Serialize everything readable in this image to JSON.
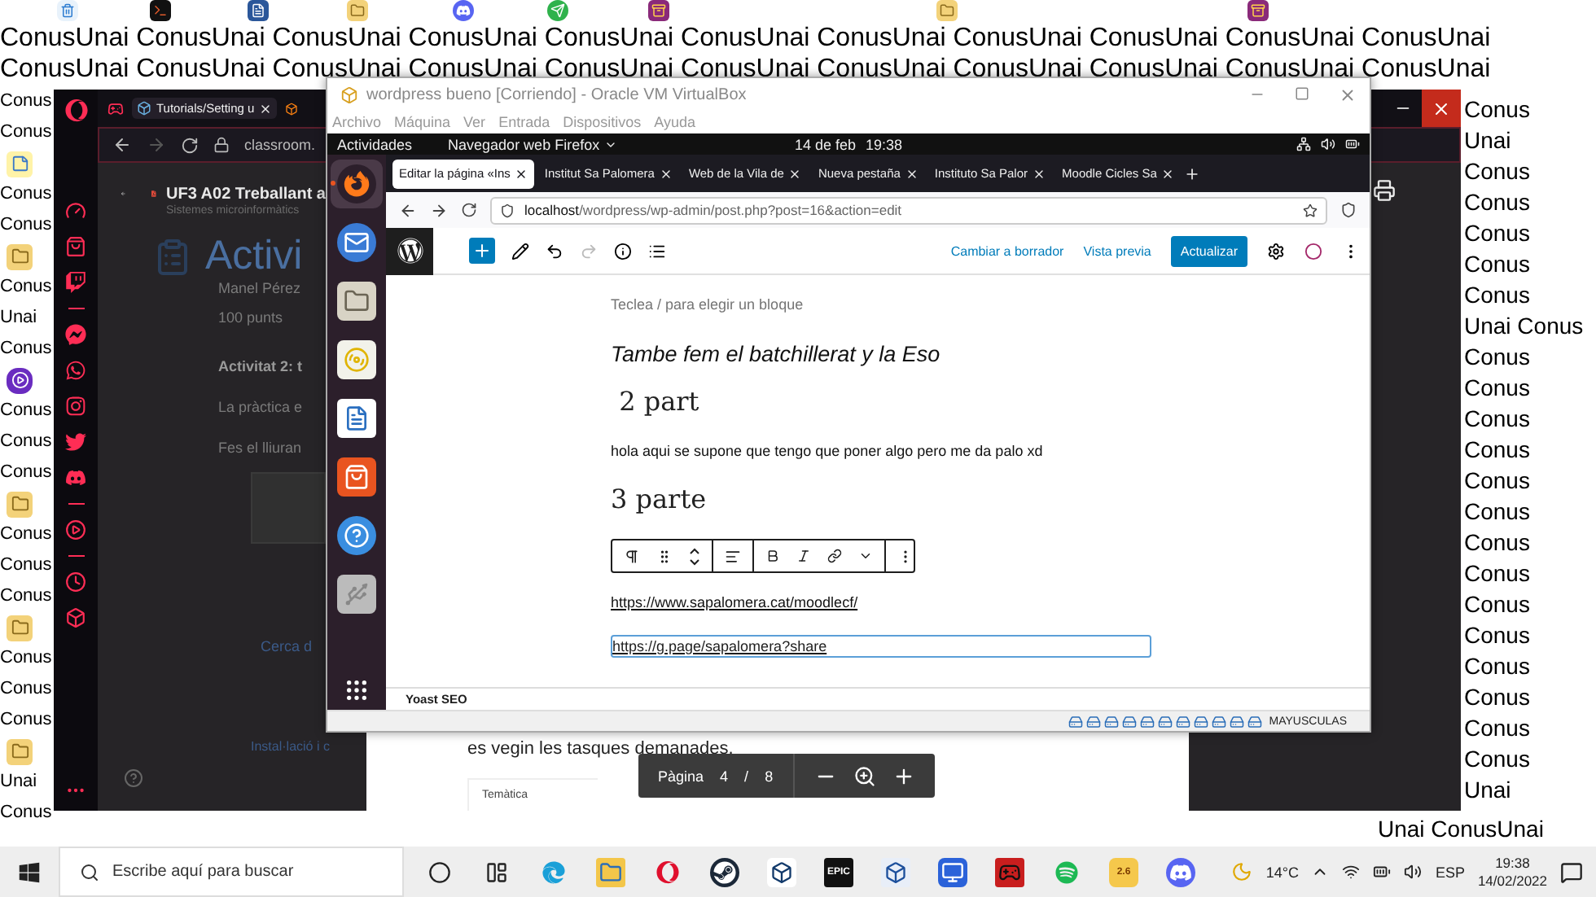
{
  "wallpaper": {
    "top_lines": [
      "ConusUnai ConusUnai ConusUnai ConusUnai ConusUnai ConusUnai ConusUnai ConusUnai ConusUnai ConusUnai ConusUnai",
      "ConusUnai ConusUnai ConusUnai ConusUnai ConusUnai ConusUnai ConusUnai ConusUnai ConusUnai ConusUnai ConusUnai"
    ],
    "left_lines": [
      {
        "kind": "text",
        "text": "Conus"
      },
      {
        "kind": "text",
        "text": "Conus"
      },
      {
        "kind": "notes"
      },
      {
        "kind": "text",
        "text": "Conus"
      },
      {
        "kind": "text",
        "text": "Conus"
      },
      {
        "kind": "folder"
      },
      {
        "kind": "text",
        "text": "Conus"
      },
      {
        "kind": "text",
        "text": "Unai"
      },
      {
        "kind": "text",
        "text": "Conus"
      },
      {
        "kind": "player"
      },
      {
        "kind": "text",
        "text": "Conus"
      },
      {
        "kind": "text",
        "text": "Conus"
      },
      {
        "kind": "text",
        "text": "Conus"
      },
      {
        "kind": "folder"
      },
      {
        "kind": "text",
        "text": "Conus"
      },
      {
        "kind": "text",
        "text": "Conus"
      },
      {
        "kind": "text",
        "text": "Conus"
      },
      {
        "kind": "folder"
      },
      {
        "kind": "text",
        "text": "Conus"
      },
      {
        "kind": "text",
        "text": "Conus"
      },
      {
        "kind": "text",
        "text": "Conus"
      },
      {
        "kind": "folder"
      },
      {
        "kind": "text",
        "text": "Unai"
      },
      {
        "kind": "text",
        "text": "Conus"
      }
    ],
    "corner_lines": [
      "Unai ConusUnai"
    ],
    "right_lines": [
      "Conus",
      "Unai",
      "Conus",
      "Conus",
      "Conus",
      "Conus",
      "Conus",
      "Unai Conus",
      "Conus",
      "Conus",
      "Conus",
      "Conus",
      "Conus",
      "Conus",
      "Conus",
      "Conus",
      "Conus",
      "Conus",
      "Conus",
      "Conus",
      "Conus",
      "Conus",
      "Unai"
    ]
  },
  "desktop_icons": [
    {
      "kind": "bin"
    },
    {
      "kind": "terminal"
    },
    {
      "kind": "document"
    },
    {
      "kind": "folder"
    },
    {
      "kind": "chat"
    },
    {
      "kind": "send"
    },
    {
      "kind": "archive"
    },
    {
      "kind": "folder"
    },
    {
      "kind": "archive"
    }
  ],
  "opera": {
    "sidebar": [
      {
        "kind": "gauge"
      },
      {
        "kind": "bag"
      },
      {
        "kind": "twitch"
      },
      {
        "kind": "divider"
      },
      {
        "kind": "messenger"
      },
      {
        "kind": "whatsapp"
      },
      {
        "kind": "instagram"
      },
      {
        "kind": "twitter"
      },
      {
        "kind": "discord"
      },
      {
        "kind": "divider"
      },
      {
        "kind": "player"
      },
      {
        "kind": "divider"
      },
      {
        "kind": "history"
      },
      {
        "kind": "cube"
      }
    ],
    "tabs": [
      {
        "label": "Tutorials/Setting u",
        "selected": true
      }
    ],
    "address": "classroom.",
    "pdf_title": "UF3 A02 Treballant a",
    "pdf_subtitle": "Sistemes microinformàtics",
    "classroom": {
      "title": "Activi",
      "author": "Manel Pérez",
      "points": "100 punts",
      "heading": "Activitat 2: t",
      "lines": [
        "La pràctica e",
        "Fes el lliuran"
      ],
      "section": "Cerca d",
      "attachment": "Instal·lació i c"
    },
    "pdf": {
      "text": "es vegin les tasques demanades.",
      "card": "Temàtica",
      "page_label": "Pàgina",
      "page": "4",
      "separator": "/",
      "total": "8"
    }
  },
  "vm": {
    "title": "wordpress bueno [Corriendo] - Oracle VM VirtualBox",
    "menu": [
      "Archivo",
      "Máquina",
      "Ver",
      "Entrada",
      "Dispositivos",
      "Ayuda"
    ],
    "ubuntu": {
      "activities": "Actividades",
      "app": "Navegador web Firefox",
      "date": "14 de feb",
      "time": "19:38"
    },
    "dock": [
      {
        "kind": "firefox",
        "selected": true
      },
      {
        "kind": "mail",
        "selected": false
      },
      {
        "kind": "files",
        "selected": false
      },
      {
        "kind": "music",
        "selected": false
      },
      {
        "kind": "writer",
        "selected": false
      },
      {
        "kind": "store",
        "selected": false
      },
      {
        "kind": "help",
        "selected": false
      },
      {
        "kind": "usb",
        "selected": false
      }
    ],
    "tabs": [
      {
        "label": "Editar la página «Ins",
        "selected": true
      },
      {
        "label": "Institut Sa Palomera",
        "selected": false
      },
      {
        "label": "Web de la Vila de",
        "selected": false
      },
      {
        "label": "Nueva pestaña",
        "selected": false
      },
      {
        "label": "Instituto Sa Palor",
        "selected": false
      },
      {
        "label": "Moodle Cicles Sa",
        "selected": false
      }
    ],
    "url_host": "localhost",
    "url_path": "/wordpress/wp-admin/post.php?post=16&action=edit",
    "wp": {
      "draft": "Cambiar a borrador",
      "preview": "Vista previa",
      "update": "Actualizar",
      "blocks": [
        {
          "kind": "placeholder",
          "text": "Teclea / para elegir un bloque"
        },
        {
          "kind": "italic",
          "text": "Tambe fem el batchillerat y la Eso"
        },
        {
          "kind": "heading",
          "text": " 2 part"
        },
        {
          "kind": "paragraph",
          "text": "hola aqui se supone que tengo que poner algo pero me da palo xd"
        },
        {
          "kind": "heading",
          "text": "3 parte"
        },
        {
          "kind": "toolbar"
        },
        {
          "kind": "link",
          "text": "https://www.sapalomera.cat/moodlecf/"
        },
        {
          "kind": "selected-link",
          "text": "https://g.page/sapalomera?share"
        }
      ],
      "yoast": "Yoast SEO"
    },
    "status": "MAYUSCULAS"
  },
  "taskbar": {
    "search": "Escribe aquí para buscar",
    "apps": [
      {
        "kind": "cortana"
      },
      {
        "kind": "taskview"
      },
      {
        "kind": "edge"
      },
      {
        "kind": "explorer"
      },
      {
        "kind": "opera"
      },
      {
        "kind": "steam"
      },
      {
        "kind": "cube"
      },
      {
        "kind": "epic",
        "label": "EPIC"
      },
      {
        "kind": "vbox"
      },
      {
        "kind": "remote"
      },
      {
        "kind": "red"
      },
      {
        "kind": "spotify"
      },
      {
        "kind": "badge",
        "label": "2.6"
      },
      {
        "kind": "discord"
      }
    ],
    "temperature": "14°C",
    "language": "ESP",
    "time": "19:38",
    "date": "14/02/2022"
  }
}
